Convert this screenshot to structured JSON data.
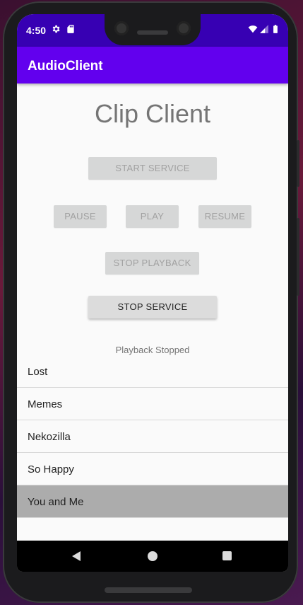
{
  "status_bar": {
    "time": "4:50"
  },
  "app_bar": {
    "title": "AudioClient"
  },
  "main": {
    "title": "Clip Client",
    "buttons": {
      "start_service": "START SERVICE",
      "pause": "PAUSE",
      "play": "PLAY",
      "resume": "RESUME",
      "stop_playback": "STOP PLAYBACK",
      "stop_service": "STOP SERVICE"
    },
    "status": "Playback Stopped",
    "clips": [
      {
        "label": "Lost"
      },
      {
        "label": "Memes"
      },
      {
        "label": "Nekozilla"
      },
      {
        "label": "So Happy"
      },
      {
        "label": "You and Me",
        "selected": true
      }
    ]
  },
  "colors": {
    "status_bar": "#3700b3",
    "app_bar": "#6200ee",
    "selected_item": "#acacac"
  }
}
